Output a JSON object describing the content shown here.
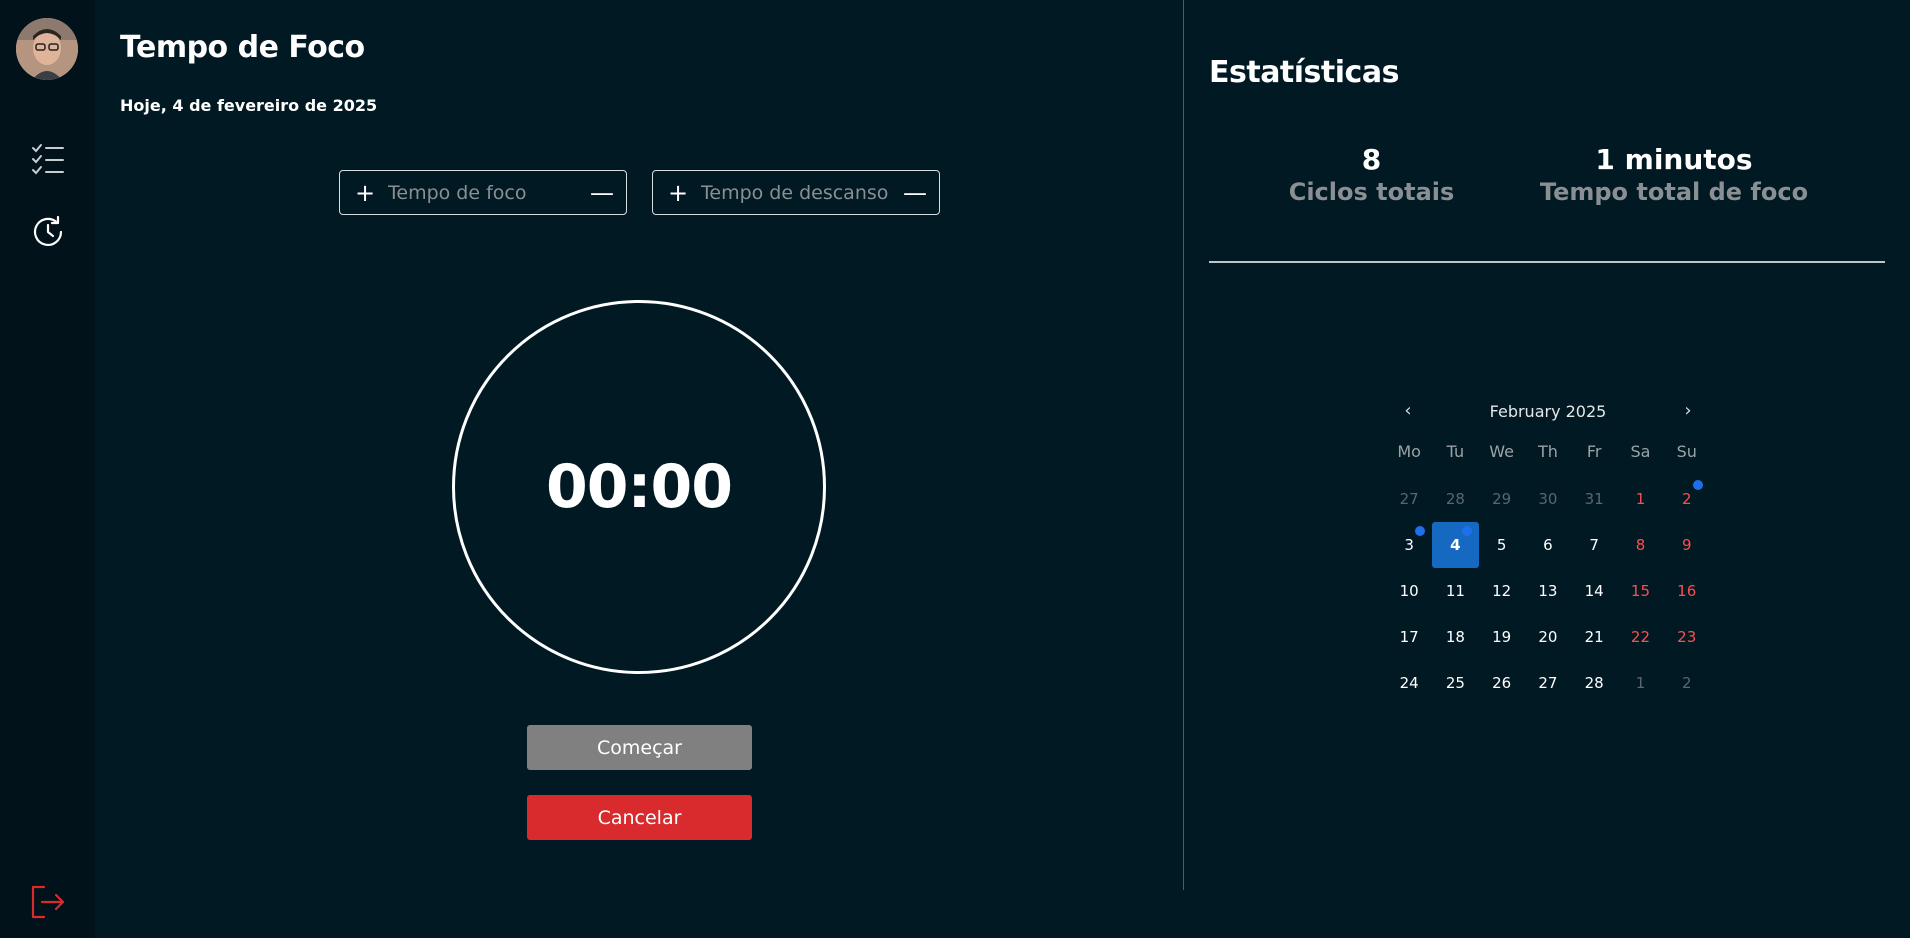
{
  "app": {
    "title": "Tempo de Foco",
    "date_line": "Hoje, 4 de fevereiro de 2025"
  },
  "sidebar": {
    "items": [
      {
        "name": "tasks",
        "icon": "checklist-icon"
      },
      {
        "name": "history",
        "icon": "history-icon"
      }
    ],
    "logout_icon": "logout-icon"
  },
  "controls": {
    "focus": {
      "placeholder": "Tempo de foco",
      "value": ""
    },
    "rest": {
      "placeholder": "Tempo de descanso",
      "value": ""
    },
    "plus_symbol": "+",
    "minus_symbol": "—"
  },
  "timer": {
    "display": "00:00"
  },
  "buttons": {
    "start": "Começar",
    "cancel": "Cancelar"
  },
  "stats": {
    "title": "Estatísticas",
    "cycles_value": "8",
    "cycles_label": "Ciclos totais",
    "focus_value": "1 minutos",
    "focus_label": "Tempo total de foco"
  },
  "calendar": {
    "month_label": "February 2025",
    "prev_symbol": "‹",
    "next_symbol": "›",
    "weekdays": [
      "Mo",
      "Tu",
      "We",
      "Th",
      "Fr",
      "Sa",
      "Su"
    ],
    "days": [
      {
        "label": "27",
        "outside": true
      },
      {
        "label": "28",
        "outside": true
      },
      {
        "label": "29",
        "outside": true
      },
      {
        "label": "30",
        "outside": true
      },
      {
        "label": "31",
        "outside": true
      },
      {
        "label": "1",
        "weekend": true
      },
      {
        "label": "2",
        "weekend": true,
        "dot": true
      },
      {
        "label": "3",
        "dot": true
      },
      {
        "label": "4",
        "selected": true,
        "dot": true
      },
      {
        "label": "5"
      },
      {
        "label": "6"
      },
      {
        "label": "7"
      },
      {
        "label": "8",
        "weekend": true
      },
      {
        "label": "9",
        "weekend": true
      },
      {
        "label": "10"
      },
      {
        "label": "11"
      },
      {
        "label": "12"
      },
      {
        "label": "13"
      },
      {
        "label": "14"
      },
      {
        "label": "15",
        "weekend": true
      },
      {
        "label": "16",
        "weekend": true
      },
      {
        "label": "17"
      },
      {
        "label": "18"
      },
      {
        "label": "19"
      },
      {
        "label": "20"
      },
      {
        "label": "21"
      },
      {
        "label": "22",
        "weekend": true
      },
      {
        "label": "23",
        "weekend": true
      },
      {
        "label": "24"
      },
      {
        "label": "25"
      },
      {
        "label": "26"
      },
      {
        "label": "27"
      },
      {
        "label": "28"
      },
      {
        "label": "1",
        "outside": true,
        "weekend": true
      },
      {
        "label": "2",
        "outside": true,
        "weekend": true
      }
    ]
  },
  "colors": {
    "background": "#011923",
    "sidebar": "#01121a",
    "accent_blue": "#1669c1",
    "danger": "#d92b2d",
    "muted": "#8a8f93",
    "weekend": "#ff4d4f",
    "logout": "#d92b2d"
  }
}
